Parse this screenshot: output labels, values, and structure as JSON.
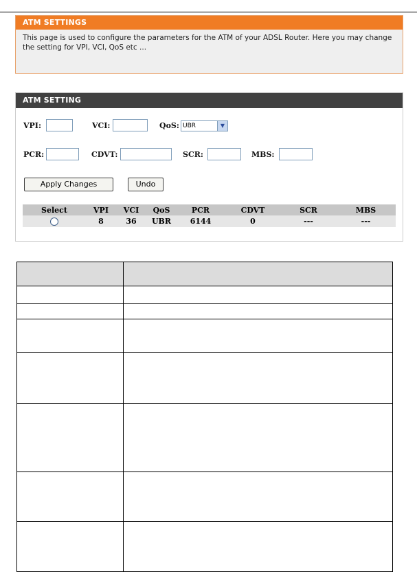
{
  "header": {
    "title": "ATM SETTINGS",
    "description": "This page is used to configure the parameters for the ATM of your ADSL Router. Here you may change the setting for VPI, VCI, QoS etc ..."
  },
  "panel": {
    "title": "ATM SETTING",
    "labels": {
      "vpi": "VPI:",
      "vci": "VCI:",
      "qos": "QoS:",
      "pcr": "PCR:",
      "cdvt": "CDVT:",
      "scr": "SCR:",
      "mbs": "MBS:"
    },
    "qos_selected": "UBR",
    "buttons": {
      "apply": "Apply Changes",
      "undo": "Undo"
    },
    "table": {
      "headers": [
        "Select",
        "VPI",
        "VCI",
        "QoS",
        "PCR",
        "CDVT",
        "SCR",
        "MBS"
      ],
      "rows": [
        {
          "vpi": "8",
          "vci": "36",
          "qos": "UBR",
          "pcr": "6144",
          "cdvt": "0",
          "scr": "---",
          "mbs": "---"
        }
      ]
    }
  },
  "icons": {
    "dropdown": "chevron-down-icon",
    "radio": "radio-button"
  }
}
